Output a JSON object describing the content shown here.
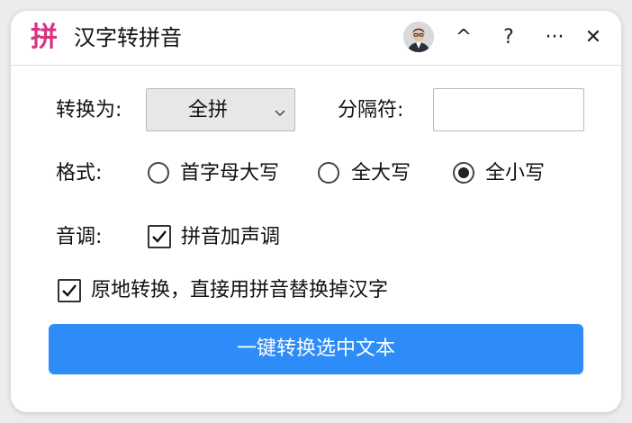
{
  "window": {
    "logo_text": "拼",
    "title": "汉字转拼音",
    "accent_color": "#d63384",
    "controls": {
      "collapse_symbol": "^",
      "help_symbol": "?",
      "more_symbol": "···",
      "close_symbol": "✕"
    }
  },
  "form": {
    "convert_to_label": "转换为:",
    "convert_to_selected": "全拼",
    "separator_label": "分隔符:",
    "separator_value": "",
    "format_label": "格式:",
    "format_options": [
      {
        "label": "首字母大写",
        "checked": false
      },
      {
        "label": "全大写",
        "checked": false
      },
      {
        "label": "全小写",
        "checked": true
      }
    ],
    "tone_label": "音调:",
    "tone_checkbox_label": "拼音加声调",
    "tone_checked": true,
    "inplace_checkbox_label": "原地转换，直接用拼音替换掉汉字",
    "inplace_checked": true
  },
  "actions": {
    "convert_button_label": "一键转换选中文本",
    "button_color": "#2d8cf7"
  }
}
